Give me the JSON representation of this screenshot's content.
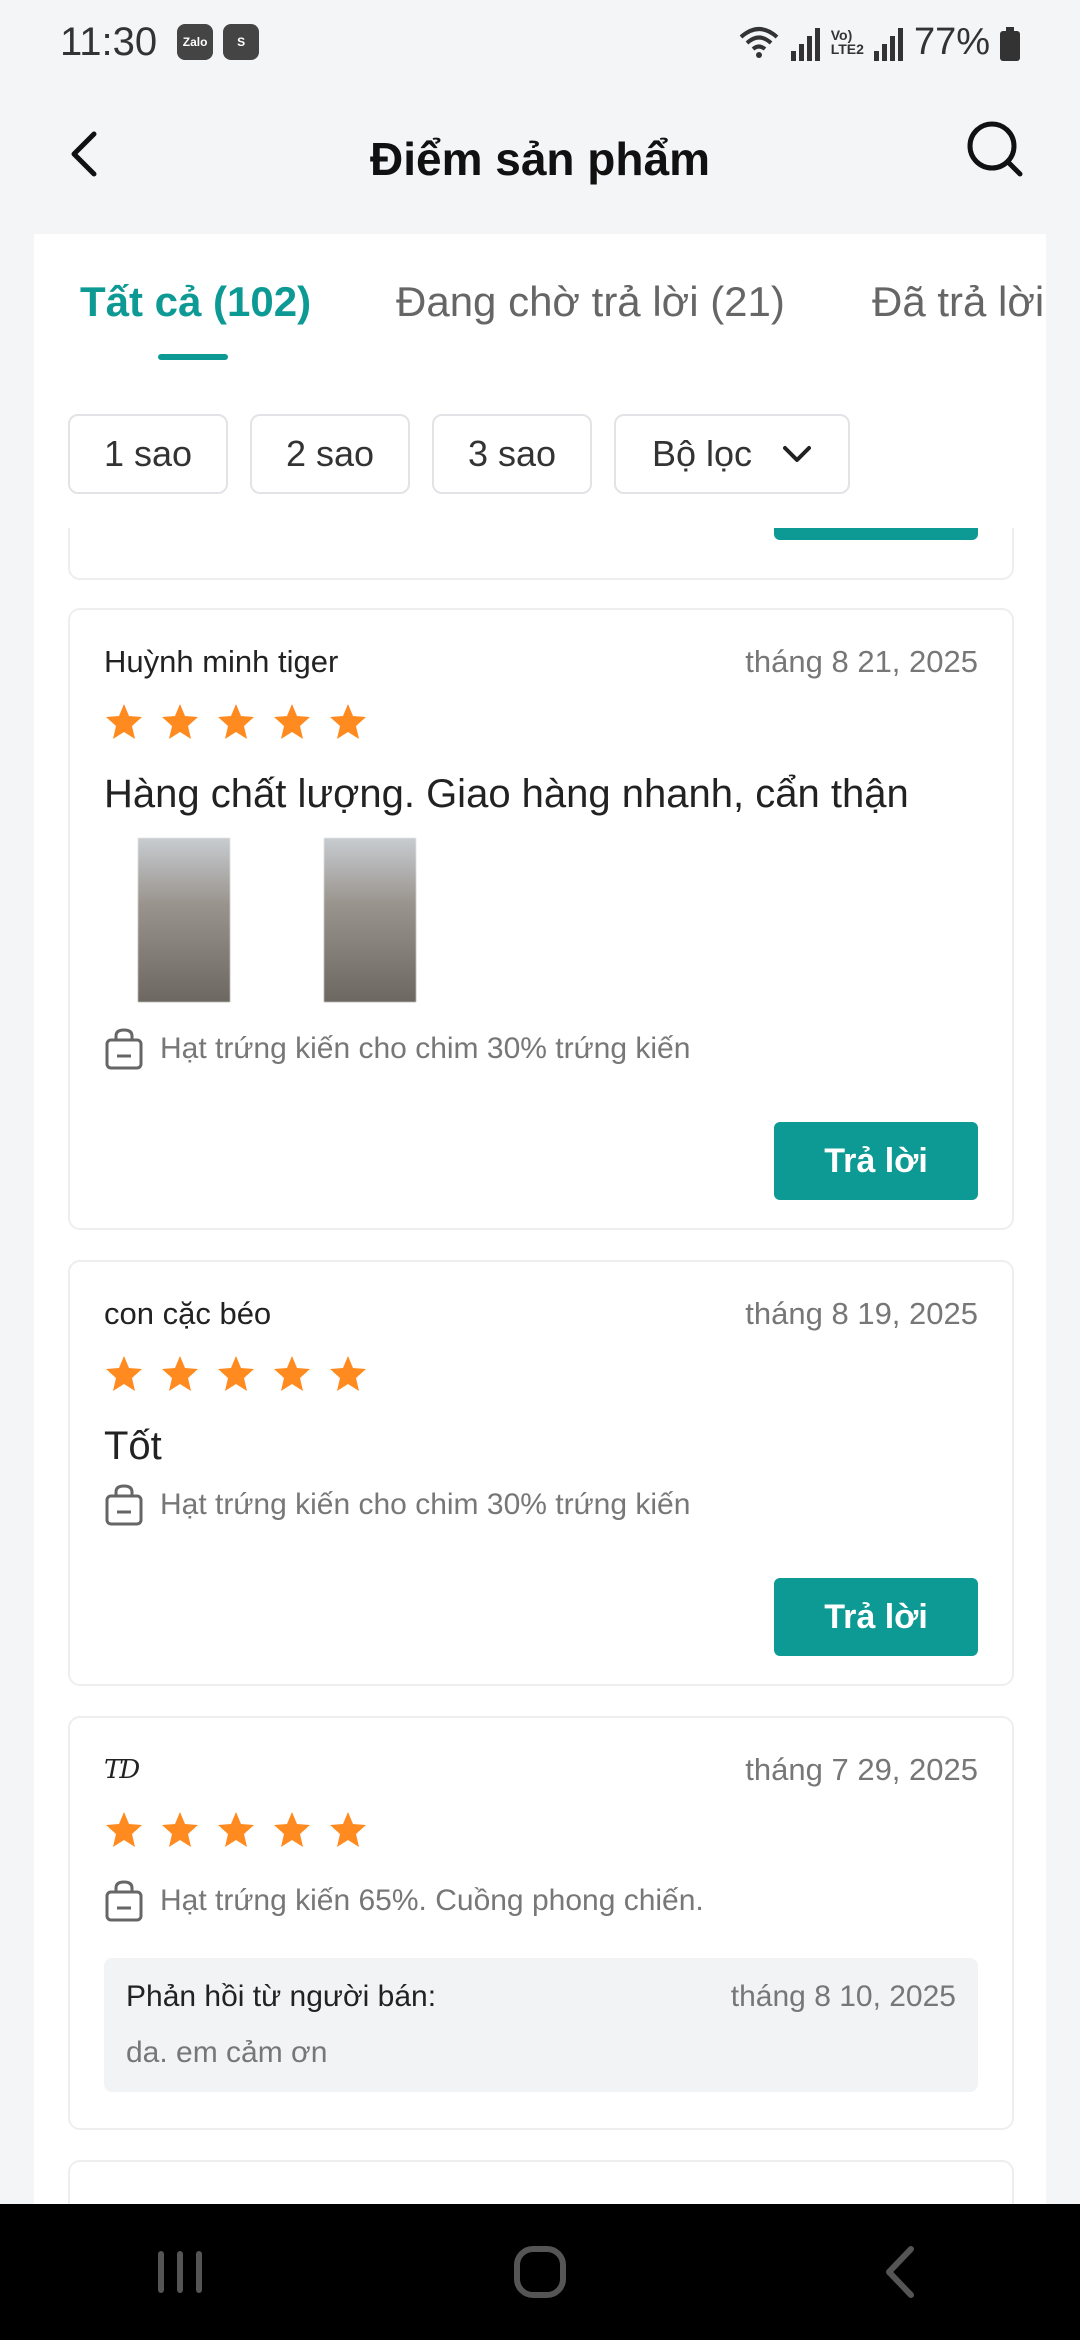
{
  "status_bar": {
    "time": "11:30",
    "app_icons": [
      "Zalo",
      "S"
    ],
    "battery": "77%"
  },
  "header": {
    "title": "Điểm sản phẩm",
    "back_icon": "chevron-left-icon",
    "search_icon": "search-icon"
  },
  "tabs": [
    {
      "label": "Tất cả (102)",
      "active": true
    },
    {
      "label": "Đang chờ trả lời (21)",
      "active": false
    },
    {
      "label": "Đã trả lời",
      "active": false
    }
  ],
  "filters": [
    {
      "label": "1 sao"
    },
    {
      "label": "2 sao"
    },
    {
      "label": "3 sao"
    },
    {
      "label": "Bộ lọc"
    }
  ],
  "colors": {
    "accent": "#0e9a94",
    "star": "#ff8a1f"
  },
  "reviews": [
    {
      "user": "Huỳnh minh tiger",
      "date": "tháng 8 21, 2025",
      "rating": 5,
      "text": "Hàng chất lượng. Giao hàng nhanh, cẩn thận",
      "product": "Hạt trứng kiến cho chim 30% trứng kiến",
      "reply_label": "Trả lời"
    },
    {
      "user": "con cặc béo",
      "date": "tháng 8 19, 2025",
      "rating": 5,
      "text": "Tốt",
      "product": "Hạt trứng kiến cho chim 30% trứng kiến",
      "reply_label": "Trả lời"
    },
    {
      "user": "TD",
      "date": "tháng 7 29, 2025",
      "rating": 5,
      "product": "Hạt trứng kiến 65%. Cuồng phong chiến.",
      "seller_reply": {
        "label": "Phản hồi từ người bán:",
        "date": "tháng 8 10, 2025",
        "text": "da. em cảm ơn"
      }
    }
  ]
}
